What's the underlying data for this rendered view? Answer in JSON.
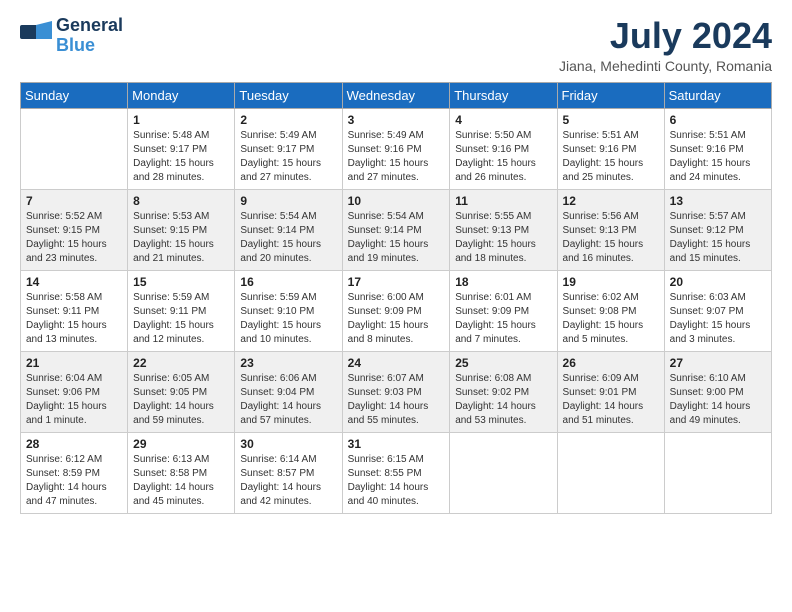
{
  "header": {
    "logo_line1": "General",
    "logo_line2": "Blue",
    "month_year": "July 2024",
    "location": "Jiana, Mehedinti County, Romania"
  },
  "weekdays": [
    "Sunday",
    "Monday",
    "Tuesday",
    "Wednesday",
    "Thursday",
    "Friday",
    "Saturday"
  ],
  "weeks": [
    [
      {
        "day": "",
        "info": ""
      },
      {
        "day": "1",
        "info": "Sunrise: 5:48 AM\nSunset: 9:17 PM\nDaylight: 15 hours\nand 28 minutes."
      },
      {
        "day": "2",
        "info": "Sunrise: 5:49 AM\nSunset: 9:17 PM\nDaylight: 15 hours\nand 27 minutes."
      },
      {
        "day": "3",
        "info": "Sunrise: 5:49 AM\nSunset: 9:16 PM\nDaylight: 15 hours\nand 27 minutes."
      },
      {
        "day": "4",
        "info": "Sunrise: 5:50 AM\nSunset: 9:16 PM\nDaylight: 15 hours\nand 26 minutes."
      },
      {
        "day": "5",
        "info": "Sunrise: 5:51 AM\nSunset: 9:16 PM\nDaylight: 15 hours\nand 25 minutes."
      },
      {
        "day": "6",
        "info": "Sunrise: 5:51 AM\nSunset: 9:16 PM\nDaylight: 15 hours\nand 24 minutes."
      }
    ],
    [
      {
        "day": "7",
        "info": "Sunrise: 5:52 AM\nSunset: 9:15 PM\nDaylight: 15 hours\nand 23 minutes."
      },
      {
        "day": "8",
        "info": "Sunrise: 5:53 AM\nSunset: 9:15 PM\nDaylight: 15 hours\nand 21 minutes."
      },
      {
        "day": "9",
        "info": "Sunrise: 5:54 AM\nSunset: 9:14 PM\nDaylight: 15 hours\nand 20 minutes."
      },
      {
        "day": "10",
        "info": "Sunrise: 5:54 AM\nSunset: 9:14 PM\nDaylight: 15 hours\nand 19 minutes."
      },
      {
        "day": "11",
        "info": "Sunrise: 5:55 AM\nSunset: 9:13 PM\nDaylight: 15 hours\nand 18 minutes."
      },
      {
        "day": "12",
        "info": "Sunrise: 5:56 AM\nSunset: 9:13 PM\nDaylight: 15 hours\nand 16 minutes."
      },
      {
        "day": "13",
        "info": "Sunrise: 5:57 AM\nSunset: 9:12 PM\nDaylight: 15 hours\nand 15 minutes."
      }
    ],
    [
      {
        "day": "14",
        "info": "Sunrise: 5:58 AM\nSunset: 9:11 PM\nDaylight: 15 hours\nand 13 minutes."
      },
      {
        "day": "15",
        "info": "Sunrise: 5:59 AM\nSunset: 9:11 PM\nDaylight: 15 hours\nand 12 minutes."
      },
      {
        "day": "16",
        "info": "Sunrise: 5:59 AM\nSunset: 9:10 PM\nDaylight: 15 hours\nand 10 minutes."
      },
      {
        "day": "17",
        "info": "Sunrise: 6:00 AM\nSunset: 9:09 PM\nDaylight: 15 hours\nand 8 minutes."
      },
      {
        "day": "18",
        "info": "Sunrise: 6:01 AM\nSunset: 9:09 PM\nDaylight: 15 hours\nand 7 minutes."
      },
      {
        "day": "19",
        "info": "Sunrise: 6:02 AM\nSunset: 9:08 PM\nDaylight: 15 hours\nand 5 minutes."
      },
      {
        "day": "20",
        "info": "Sunrise: 6:03 AM\nSunset: 9:07 PM\nDaylight: 15 hours\nand 3 minutes."
      }
    ],
    [
      {
        "day": "21",
        "info": "Sunrise: 6:04 AM\nSunset: 9:06 PM\nDaylight: 15 hours\nand 1 minute."
      },
      {
        "day": "22",
        "info": "Sunrise: 6:05 AM\nSunset: 9:05 PM\nDaylight: 14 hours\nand 59 minutes."
      },
      {
        "day": "23",
        "info": "Sunrise: 6:06 AM\nSunset: 9:04 PM\nDaylight: 14 hours\nand 57 minutes."
      },
      {
        "day": "24",
        "info": "Sunrise: 6:07 AM\nSunset: 9:03 PM\nDaylight: 14 hours\nand 55 minutes."
      },
      {
        "day": "25",
        "info": "Sunrise: 6:08 AM\nSunset: 9:02 PM\nDaylight: 14 hours\nand 53 minutes."
      },
      {
        "day": "26",
        "info": "Sunrise: 6:09 AM\nSunset: 9:01 PM\nDaylight: 14 hours\nand 51 minutes."
      },
      {
        "day": "27",
        "info": "Sunrise: 6:10 AM\nSunset: 9:00 PM\nDaylight: 14 hours\nand 49 minutes."
      }
    ],
    [
      {
        "day": "28",
        "info": "Sunrise: 6:12 AM\nSunset: 8:59 PM\nDaylight: 14 hours\nand 47 minutes."
      },
      {
        "day": "29",
        "info": "Sunrise: 6:13 AM\nSunset: 8:58 PM\nDaylight: 14 hours\nand 45 minutes."
      },
      {
        "day": "30",
        "info": "Sunrise: 6:14 AM\nSunset: 8:57 PM\nDaylight: 14 hours\nand 42 minutes."
      },
      {
        "day": "31",
        "info": "Sunrise: 6:15 AM\nSunset: 8:55 PM\nDaylight: 14 hours\nand 40 minutes."
      },
      {
        "day": "",
        "info": ""
      },
      {
        "day": "",
        "info": ""
      },
      {
        "day": "",
        "info": ""
      }
    ]
  ]
}
